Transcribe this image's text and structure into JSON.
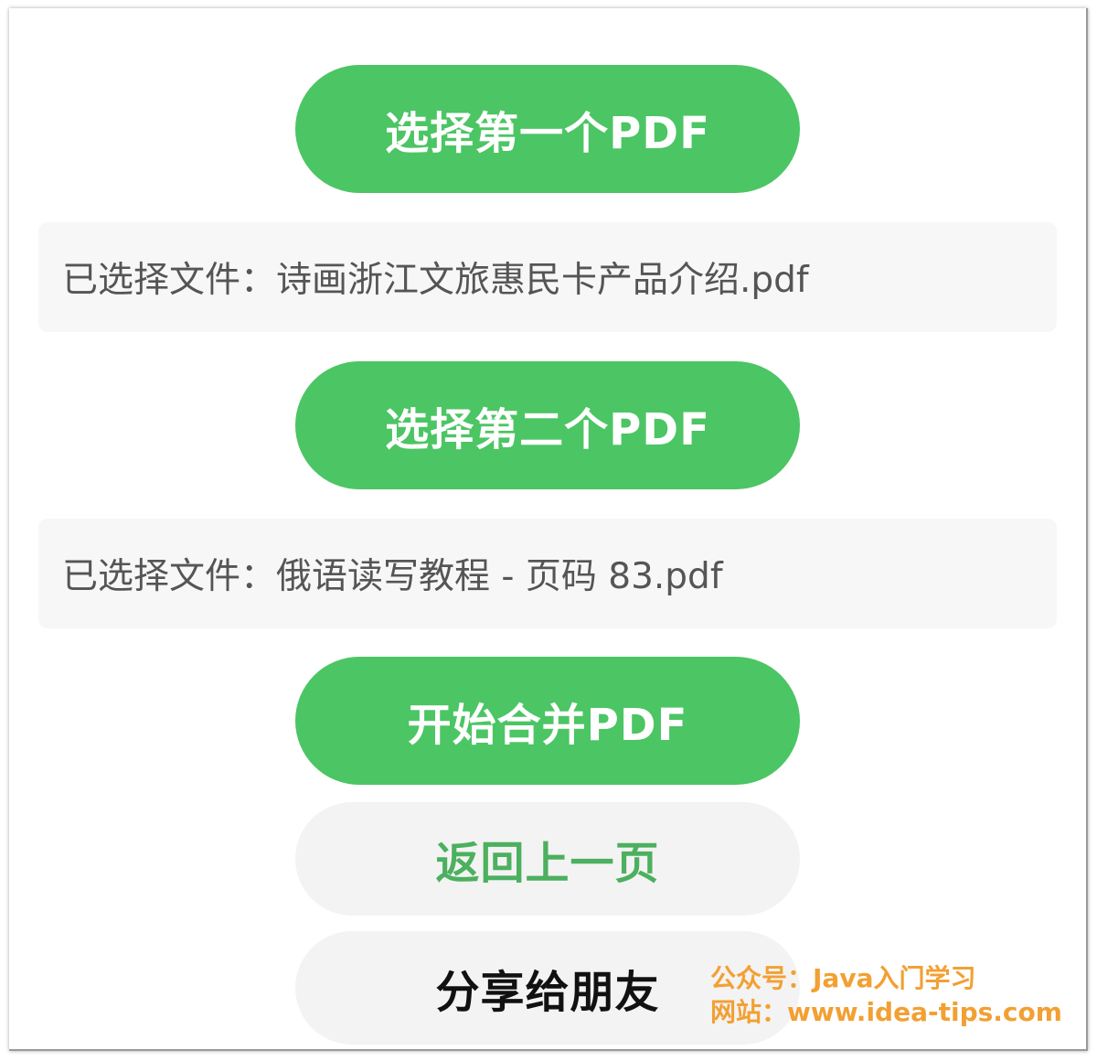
{
  "buttons": {
    "select_first": "选择第一个PDF",
    "select_second": "选择第二个PDF",
    "merge": "开始合并PDF",
    "back": "返回上一页",
    "share": "分享给朋友"
  },
  "files": {
    "prefix": "已选择文件：",
    "first_name": "诗画浙江文旅惠民卡产品介绍.pdf",
    "second_name": "俄语读写教程 - 页码 83.pdf"
  },
  "watermark": {
    "line1": "公众号：Java入门学习",
    "line2": "网站：www.idea-tips.com"
  },
  "colors": {
    "primary_green": "#4cc564",
    "secondary_bg": "#f3f3f3",
    "back_text": "#4cb05f",
    "share_text": "#111111",
    "watermark": "#f2a033"
  }
}
